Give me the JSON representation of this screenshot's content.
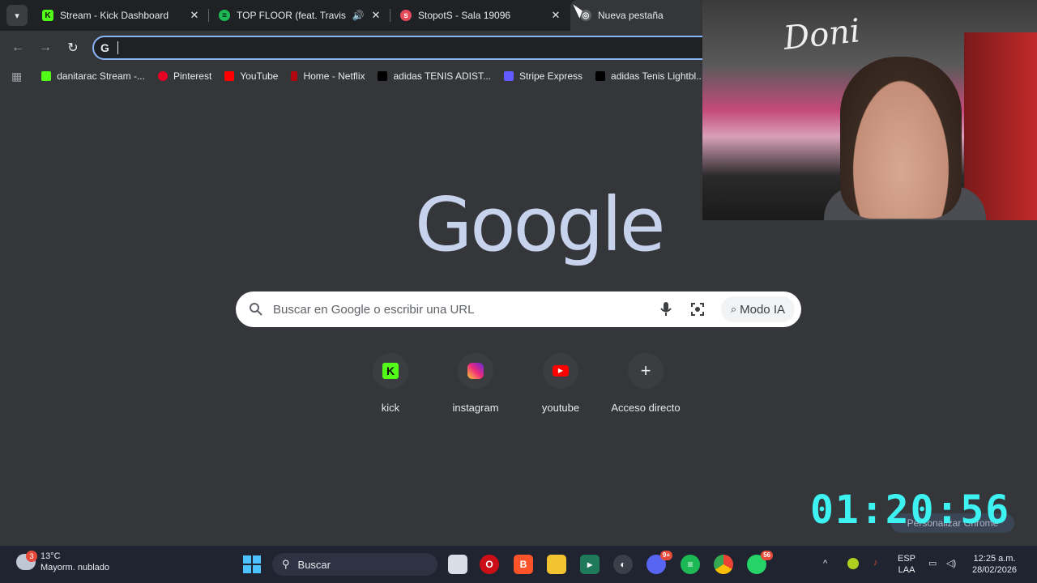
{
  "tabs": [
    {
      "title": "Stream - Kick Dashboard",
      "favicon": "kick-icon",
      "color": "#53fc18"
    },
    {
      "title": "TOP FLOOR (feat. Travis Sco",
      "favicon": "spotify-icon",
      "color": "#1db954",
      "audio": true
    },
    {
      "title": "StopotS - Sala 19096",
      "favicon": "stopots-icon",
      "color": "#e64a5a"
    },
    {
      "title": "Nueva pestaña",
      "favicon": "chrome-icon",
      "color": "#9aa0a6"
    }
  ],
  "omnibox": {
    "prefix": "G",
    "value": ""
  },
  "bookmarks": [
    {
      "label": "danitarac Stream -...",
      "color": "#53fc18"
    },
    {
      "label": "Pinterest",
      "color": "#e60023"
    },
    {
      "label": "YouTube",
      "color": "#ff0000"
    },
    {
      "label": "Home - Netflix",
      "color": "#b20710"
    },
    {
      "label": "adidas TENIS ADIST...",
      "color": "#202124"
    },
    {
      "label": "Stripe Express",
      "color": "#635bff"
    },
    {
      "label": "adidas Tenis Lightbl...",
      "color": "#202124"
    }
  ],
  "google": {
    "logo": "Google",
    "search_placeholder": "Buscar en Google o escribir una URL",
    "ai_mode_label": "Modo IA"
  },
  "shortcuts": [
    {
      "label": "kick",
      "icon": "kick-icon"
    },
    {
      "label": "instagram",
      "icon": "instagram-icon"
    },
    {
      "label": "youtube",
      "icon": "youtube-icon"
    },
    {
      "label": "Acceso directo",
      "icon": "plus-icon"
    }
  ],
  "timer": "01:20:56",
  "personalize_label": "Personalizar Chrome",
  "taskbar": {
    "weather_temp": "13°C",
    "weather_desc": "Mayorm. nublado",
    "weather_badge": "3",
    "search_label": "Buscar",
    "discord_badge": "9+",
    "whatsapp_badge": "56",
    "lang_top": "ESP",
    "lang_bottom": "LAA",
    "time": "12:25 a.m.",
    "date": "28/02/2026"
  }
}
